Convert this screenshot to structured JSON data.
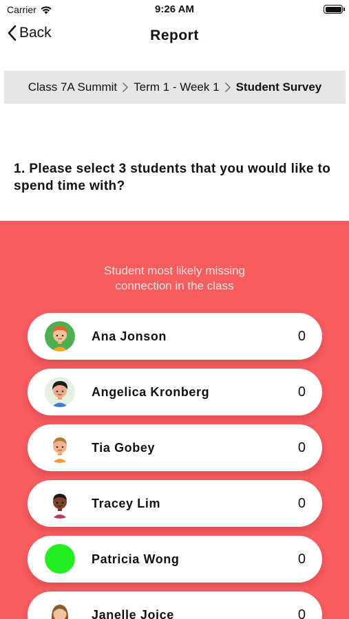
{
  "status_bar": {
    "carrier": "Carrier",
    "time": "9:26 AM"
  },
  "nav": {
    "back_label": "Back",
    "title": "Report"
  },
  "breadcrumb": {
    "items": [
      "Class 7A Summit",
      "Term 1 - Week 1",
      "Student Survey"
    ]
  },
  "question": "1. Please select 3 students that you would like to spend time with?",
  "panel": {
    "caption_line1": "Student most likely missing",
    "caption_line2": "connection in the class",
    "background": "#f75c5f"
  },
  "students": [
    {
      "name": "Ana Jonson",
      "score": "0",
      "avatar": "boy-redhead-avatar"
    },
    {
      "name": "Angelica Kronberg",
      "score": "0",
      "avatar": "boy-black-hair-avatar"
    },
    {
      "name": "Tia Gobey",
      "score": "0",
      "avatar": "boy-brown-hair-avatar"
    },
    {
      "name": "Tracey Lim",
      "score": "0",
      "avatar": "boy-dark-skin-avatar"
    },
    {
      "name": "Patricia Wong",
      "score": "0",
      "avatar": "green-placeholder-avatar"
    },
    {
      "name": "Janelle Joice",
      "score": "0",
      "avatar": "girl-brown-hair-avatar"
    }
  ]
}
